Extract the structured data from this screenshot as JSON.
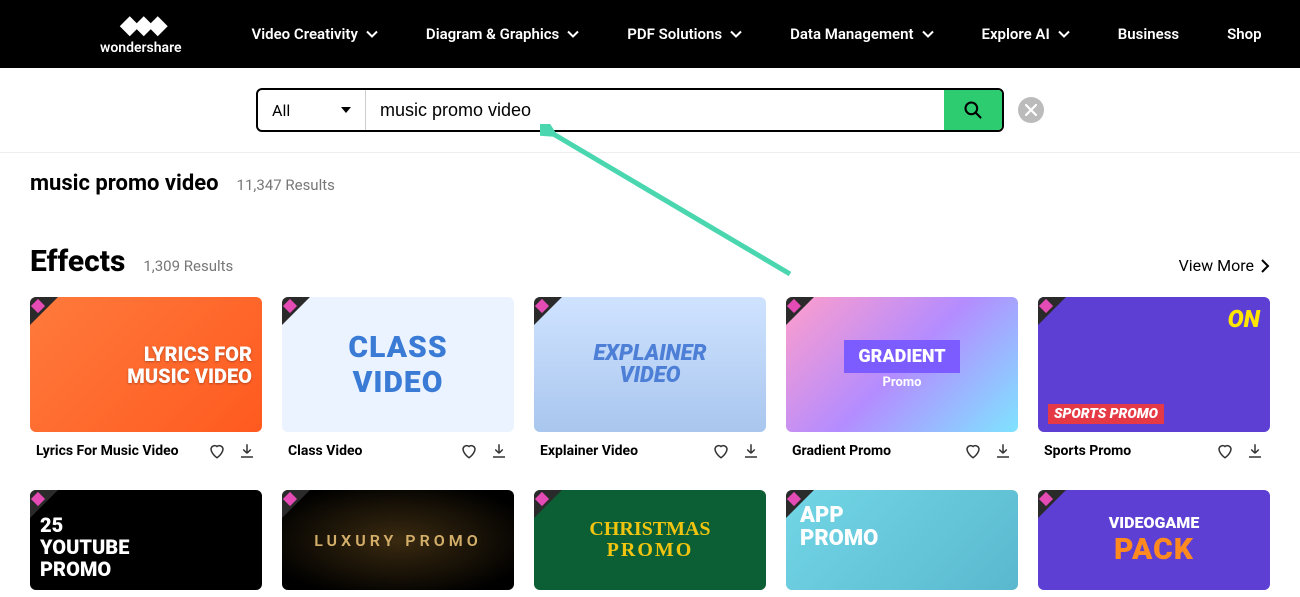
{
  "brand": {
    "name": "wondershare"
  },
  "nav": {
    "items": [
      {
        "label": "Video Creativity",
        "dropdown": true
      },
      {
        "label": "Diagram & Graphics",
        "dropdown": true
      },
      {
        "label": "PDF Solutions",
        "dropdown": true
      },
      {
        "label": "Data Management",
        "dropdown": true
      },
      {
        "label": "Explore AI",
        "dropdown": true
      },
      {
        "label": "Business",
        "dropdown": false
      },
      {
        "label": "Shop",
        "dropdown": false
      }
    ]
  },
  "search": {
    "category": "All",
    "query": "music promo video",
    "placeholder": ""
  },
  "results": {
    "query_echo": "music promo video",
    "total_text": "11,347 Results"
  },
  "section": {
    "title": "Effects",
    "count_text": "1,309 Results",
    "view_more": "View More"
  },
  "cards_row1": [
    {
      "title": "Lyrics For Music Video",
      "overlay1": "LYRICS FOR\nMUSIC VIDEO"
    },
    {
      "title": "Class Video",
      "overlay1": "CLASS\nVIDEO"
    },
    {
      "title": "Explainer Video",
      "overlay1": "EXPLAINER\nVIDEO"
    },
    {
      "title": "Gradient Promo",
      "overlay1": "GRADIENT",
      "overlay2": "Promo"
    },
    {
      "title": "Sports Promo",
      "overlay1": "ON",
      "overlay2": "SPORTS PROMO"
    }
  ],
  "cards_row2": [
    {
      "overlay1": "25\nYOUTUBE\nPROMO"
    },
    {
      "overlay1": "LUXURY PROMO"
    },
    {
      "overlay1": "CHRISTMAS",
      "overlay2": "PROMO"
    },
    {
      "overlay1": "APP\nPROMO"
    },
    {
      "overlay1": "VIDEOGAME",
      "overlay2": "PACK"
    }
  ],
  "colors": {
    "accent": "#2ecc71",
    "arrow": "#4ad7b0"
  }
}
